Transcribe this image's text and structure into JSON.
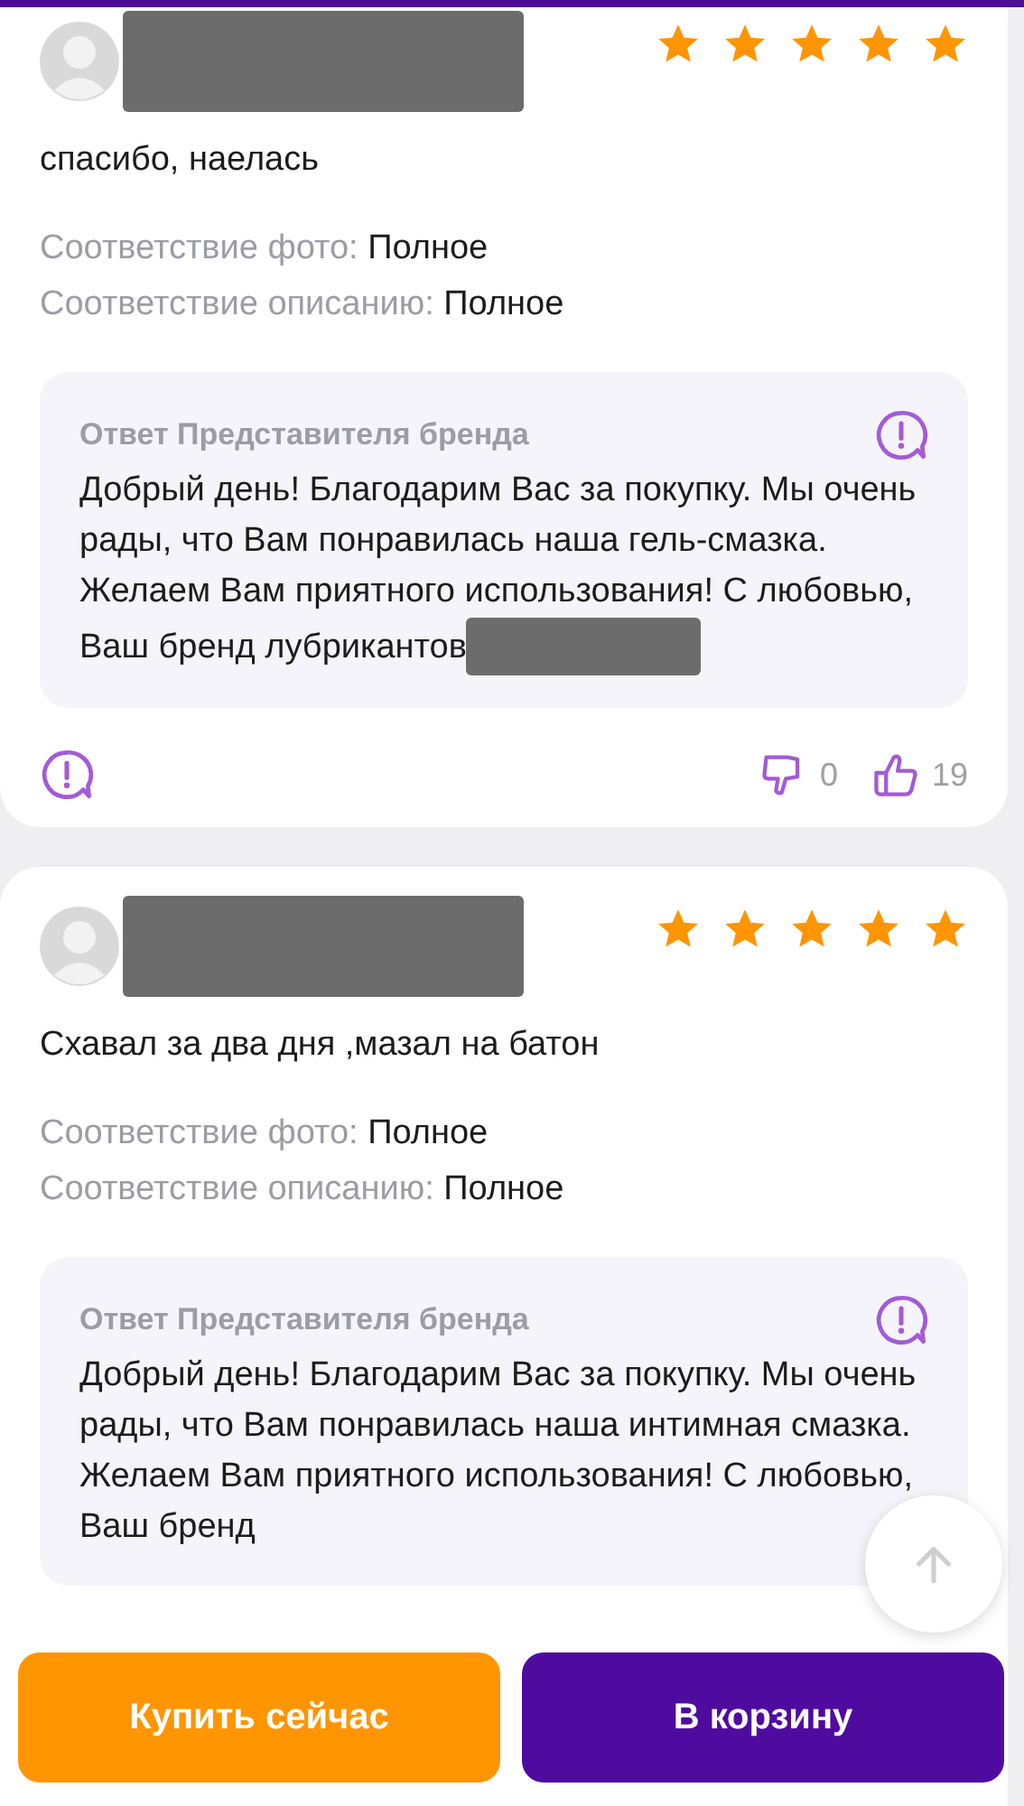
{
  "reviews": [
    {
      "stars": 5,
      "text": "спасибо, наелась",
      "attributes": [
        {
          "label": "Соответствие фото:",
          "value": "Полное"
        },
        {
          "label": "Соответствие описанию:",
          "value": "Полное"
        }
      ],
      "reply": {
        "title": "Ответ Представителя бренда",
        "text": "Добрый день! Благодарим Вас за покупку. Мы очень рады, что Вам понравилась наша гель-смазка. Желаем Вам приятного использования! С любовью, Ваш бренд лубрикантов"
      },
      "dislikes": "0",
      "likes": "19"
    },
    {
      "stars": 5,
      "text": "Схавал за два дня ,мазал на батон",
      "attributes": [
        {
          "label": "Соответствие фото:",
          "value": "Полное"
        },
        {
          "label": "Соответствие описанию:",
          "value": "Полное"
        }
      ],
      "reply": {
        "title": "Ответ Представителя бренда",
        "text": "Добрый день! Благодарим Вас за покупку. Мы очень рады, что Вам понравилась наша интимная смазка. Желаем Вам приятного использования! С любовью, Ваш бренд"
      }
    }
  ],
  "buttons": [
    {
      "label": "Купить сейчас",
      "kind": "buy"
    },
    {
      "label": "В корзину",
      "kind": "cart"
    }
  ]
}
